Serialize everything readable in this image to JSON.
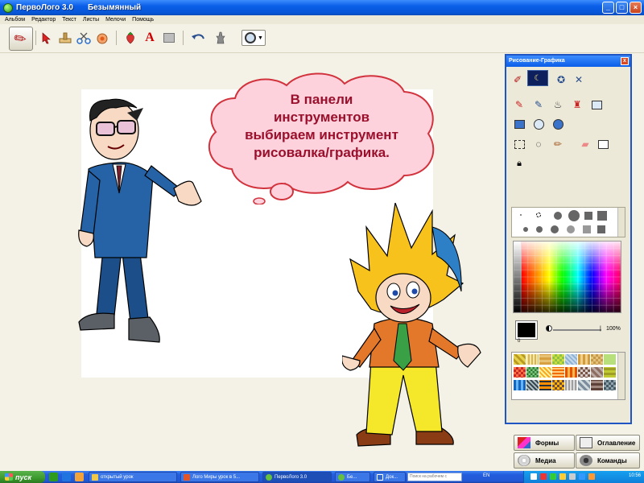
{
  "window": {
    "app_name": "ПервоЛого 3.0",
    "document_name": "Безымянный",
    "controls": {
      "minimize": "_",
      "maximize": "□",
      "close": "×"
    }
  },
  "menu": [
    "Альбом",
    "Редактор",
    "Текст",
    "Листы",
    "Мелочи",
    "Помощь"
  ],
  "toolbar": {
    "tools": [
      "drawing-tool",
      "pointer-tool",
      "scissors-tool",
      "hand-tool",
      "brush-tool",
      "fruit-tool",
      "text-tool",
      "rect-tool",
      "undo-tool",
      "turtle-tool",
      "shape-picker"
    ],
    "text_tool_glyph": "A"
  },
  "callout": {
    "lines": [
      "В панели",
      "инструментов",
      "выбираем инструмент",
      "рисовалка/графика."
    ],
    "text_color": "#9a0f2b",
    "fill_color": "#fdd2dd",
    "stroke_color": "#d2323c"
  },
  "panel": {
    "title": "Рисование-Графика",
    "close": "x",
    "opacity_label": "100%",
    "slider_end": "|",
    "swatch_number": "0"
  },
  "bottom_buttons": {
    "forms": "Формы",
    "contents": "Оглавление",
    "media": "Медиа",
    "commands": "Команды"
  },
  "taskbar": {
    "start_label": "пуск",
    "tasks": [
      {
        "label": "открытый урок",
        "icon": "folder"
      },
      {
        "label": "Лого Миры урок в 5...",
        "icon": "powerpoint"
      },
      {
        "label": "ПервоЛого 3.0",
        "icon": "logo"
      },
      {
        "label": "Бе...",
        "icon": "logo"
      },
      {
        "label": "Док...",
        "icon": "word"
      }
    ],
    "search_placeholder": "Поиск на рабочем с",
    "language": "EN",
    "clock": "10:56"
  },
  "colors": {
    "titlebar": "#0a5ee8",
    "taskbar": "#245edc",
    "start_button": "#3c9a2e",
    "panel_border": "#2055c4"
  }
}
